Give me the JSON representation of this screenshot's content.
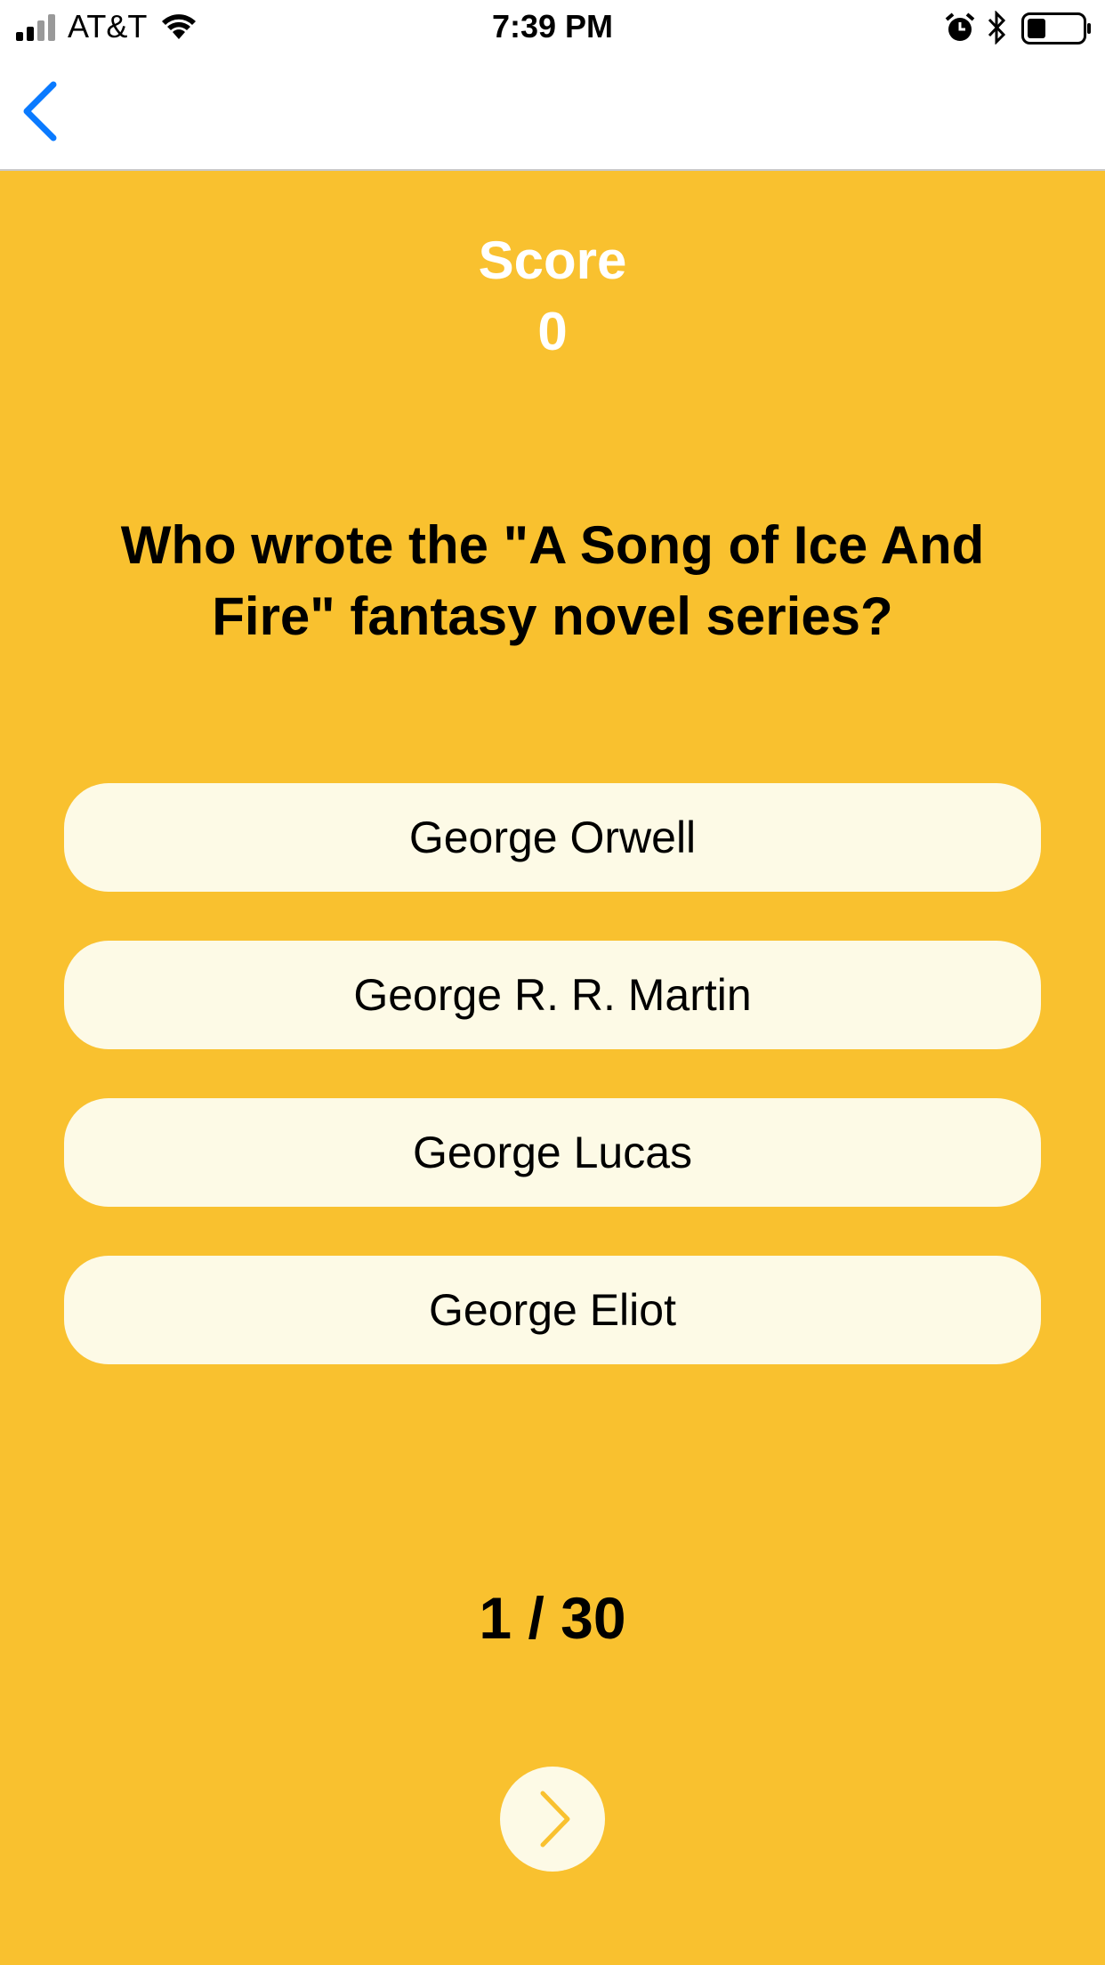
{
  "status_bar": {
    "carrier": "AT&T",
    "time": "7:39 PM",
    "icons": [
      "signal-icon",
      "wifi-icon",
      "alarm-icon",
      "bluetooth-icon",
      "battery-icon"
    ]
  },
  "nav": {
    "back_icon": "chevron-left-icon"
  },
  "quiz": {
    "score_label": "Score",
    "score_value": "0",
    "question": "Who wrote the \"A Song of Ice And Fire\" fantasy novel series?",
    "answers": [
      "George Orwell",
      "George R. R. Martin",
      "George Lucas",
      "George Eliot"
    ],
    "progress": "1 / 30",
    "next_icon": "chevron-right-icon"
  },
  "colors": {
    "background": "#F9C12F",
    "answer_button": "#FDFAE6",
    "accent_blue": "#0A7AFF",
    "score_text": "#FFFFFF"
  }
}
